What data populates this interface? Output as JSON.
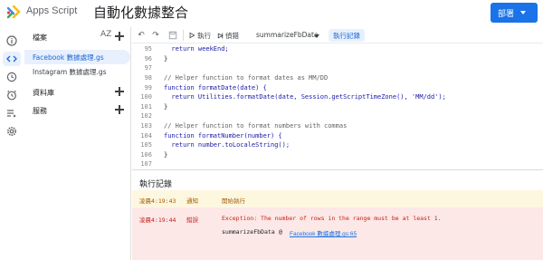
{
  "header": {
    "app_name": "Apps Script",
    "project_title": "自動化數據整合",
    "deploy_label": "部署"
  },
  "colors": {
    "accent": "#1a73e8",
    "info_bg": "#fef7e0",
    "error_bg": "#fce8e6"
  },
  "rail": [
    "info-icon",
    "code-icon",
    "history-icon",
    "alarm-icon",
    "executions-icon",
    "settings-icon"
  ],
  "panel": {
    "files_header": "檔案",
    "sort_icon": "AZ",
    "files": [
      "Facebook 數據處理.gs",
      "Instagram 數據處理.gs"
    ],
    "libraries_label": "資料庫",
    "services_label": "服務"
  },
  "toolbar": {
    "run_label": "執行",
    "debug_label": "偵錯",
    "function_name": "summarizeFbData",
    "log_label": "執行記錄"
  },
  "code": {
    "lines": [
      {
        "n": "95",
        "s": "  return weekEnd;"
      },
      {
        "n": "96",
        "s": "}"
      },
      {
        "n": "97",
        "s": ""
      },
      {
        "n": "98",
        "s": "// Helper function to format dates as MM/DD"
      },
      {
        "n": "99",
        "s": "function formatDate(date) {"
      },
      {
        "n": "100",
        "s": "  return Utilities.formatDate(date, Session.getScriptTimeZone(), 'MM/dd');"
      },
      {
        "n": "101",
        "s": "}"
      },
      {
        "n": "102",
        "s": ""
      },
      {
        "n": "103",
        "s": "// Helper function to format numbers with commas"
      },
      {
        "n": "104",
        "s": "function formatNumber(number) {"
      },
      {
        "n": "105",
        "s": "  return number.toLocaleString();"
      },
      {
        "n": "106",
        "s": "}"
      },
      {
        "n": "107",
        "s": ""
      }
    ]
  },
  "log": {
    "title": "執行記錄",
    "entries": [
      {
        "time": "凌晨4:19:43",
        "level": "通知",
        "message": "開始執行"
      },
      {
        "time": "凌晨4:19:44",
        "level": "錯誤",
        "message": "Exception: The number of rows in the range must be at least 1.",
        "stack_fn": "summarizeFbData",
        "stack_sep": "@",
        "stack_link": "Facebook 數據處理.gs:65"
      }
    ]
  }
}
